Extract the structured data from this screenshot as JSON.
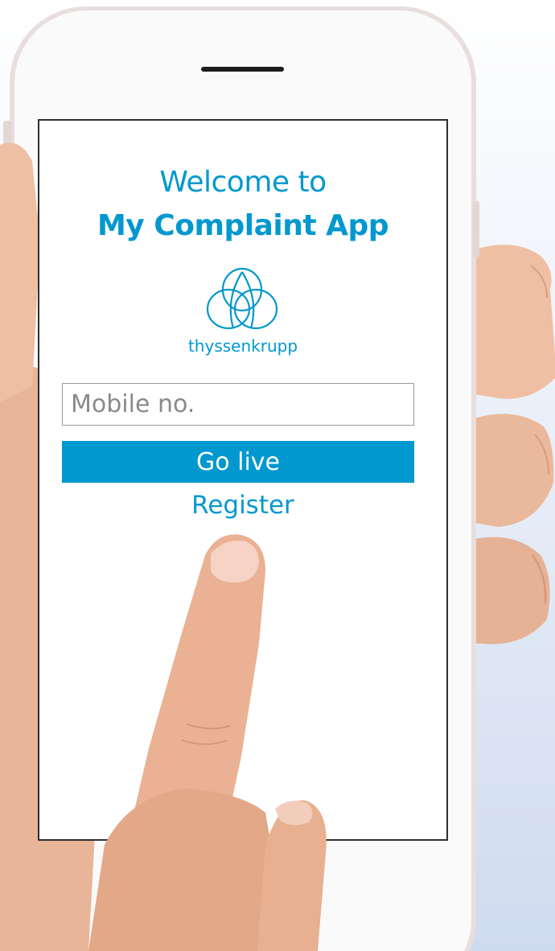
{
  "screen": {
    "welcome_line": "Welcome to",
    "app_name": "My Complaint App",
    "brand_name": "thyssenkrupp",
    "mobile_input": {
      "value": "",
      "placeholder": "Mobile no."
    },
    "go_live_label": "Go live",
    "register_label": "Register"
  },
  "colors": {
    "brand_blue": "#0098cf",
    "screen_border": "#2f2f2f",
    "phone_frame": "#f3eeee"
  },
  "icons": {
    "logo": "thyssenkrupp-logo-icon",
    "speaker": "speaker-slot-icon"
  }
}
